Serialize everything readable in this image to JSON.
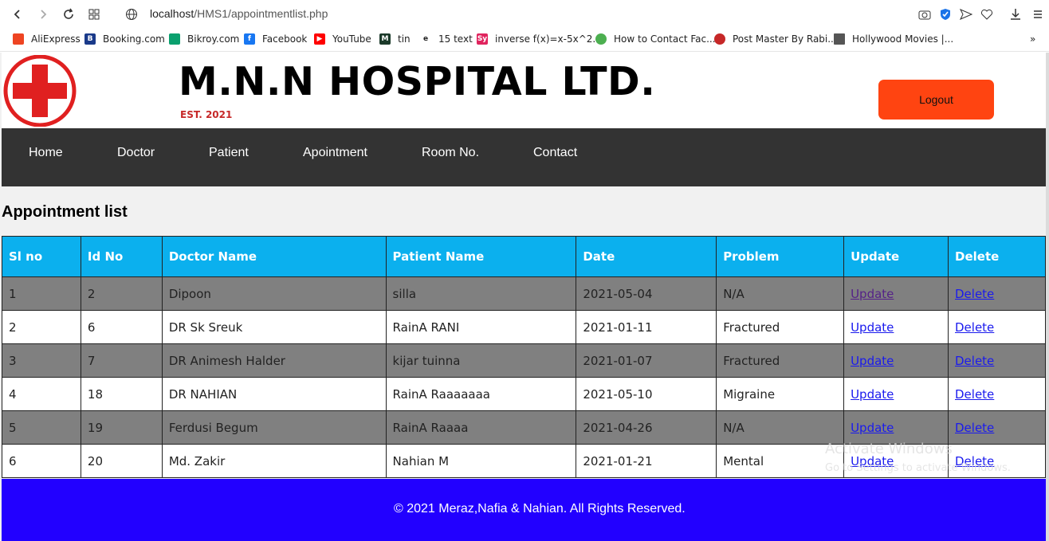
{
  "browser": {
    "url_host": "localhost",
    "url_path": "/HMS1/appointmentlist.php",
    "bookmarks": [
      {
        "label": "AliExpress",
        "icon": "aliexpress-icon",
        "color": "#ee4422"
      },
      {
        "label": "Booking.com",
        "icon": "booking-icon",
        "color": "#1a3a8a"
      },
      {
        "label": "Bikroy.com",
        "icon": "bikroy-icon",
        "color": "#0aa06e"
      },
      {
        "label": "Facebook",
        "icon": "facebook-icon",
        "color": "#1877f2"
      },
      {
        "label": "YouTube",
        "icon": "youtube-icon",
        "color": "#ff0000"
      },
      {
        "label": "tin",
        "icon": "tin-icon",
        "color": "#1b3a2a"
      },
      {
        "label": "15 text",
        "icon": "text-icon",
        "color": "#222222"
      },
      {
        "label": "inverse f(x)=x-5x^2...",
        "icon": "symbolab-icon",
        "color": "#e0245e"
      },
      {
        "label": "How to Contact Fac...",
        "icon": "location-icon",
        "color": "#4caf50"
      },
      {
        "label": "Post Master By Rabi...",
        "icon": "postmaster-icon",
        "color": "#c62828"
      },
      {
        "label": "Hollywood Movies |...",
        "icon": "document-icon",
        "color": "#555555"
      }
    ]
  },
  "header": {
    "title": "M.N.N HOSPITAL LTD.",
    "established": "EST. 2021",
    "logout_label": "Logout",
    "logout_color": "#ff4411"
  },
  "nav": {
    "items": [
      "Home",
      "Doctor",
      "Patient",
      "Apointment",
      "Room No.",
      "Contact"
    ]
  },
  "main": {
    "heading": "Appointment list",
    "columns": [
      "Sl no",
      "Id No",
      "Doctor Name",
      "Patient Name",
      "Date",
      "Problem",
      "Update",
      "Delete"
    ],
    "rows": [
      {
        "sl": "1",
        "id": "2",
        "doctor": "Dipoon",
        "patient": "silla",
        "date": "2021-05-04",
        "problem": "N/A",
        "update": "Update",
        "delete": "Delete"
      },
      {
        "sl": "2",
        "id": "6",
        "doctor": "DR Sk Sreuk",
        "patient": "RainA RANI",
        "date": "2021-01-11",
        "problem": "Fractured",
        "update": "Update",
        "delete": "Delete"
      },
      {
        "sl": "3",
        "id": "7",
        "doctor": "DR Animesh Halder",
        "patient": "kijar tuinna",
        "date": "2021-01-07",
        "problem": "Fractured",
        "update": "Update",
        "delete": "Delete"
      },
      {
        "sl": "4",
        "id": "18",
        "doctor": "DR NAHIAN",
        "patient": "RainA Raaaaaaa",
        "date": "2021-05-10",
        "problem": "Migraine",
        "update": "Update",
        "delete": "Delete"
      },
      {
        "sl": "5",
        "id": "19",
        "doctor": "Ferdusi Begum",
        "patient": "RainA Raaaa",
        "date": "2021-04-26",
        "problem": "N/A",
        "update": "Update",
        "delete": "Delete"
      },
      {
        "sl": "6",
        "id": "20",
        "doctor": "Md. Zakir",
        "patient": "Nahian M",
        "date": "2021-01-21",
        "problem": "Mental",
        "update": "Update",
        "delete": "Delete"
      }
    ],
    "header_color": "#0bb0ee",
    "odd_row_color": "#808080"
  },
  "footer": {
    "text": "© 2021 Meraz,Nafia & Nahian. All Rights Reserved.",
    "color": "#2200ff"
  },
  "watermark": {
    "title": "Activate Windows",
    "subtitle": "Go to Settings to activate Windows."
  }
}
